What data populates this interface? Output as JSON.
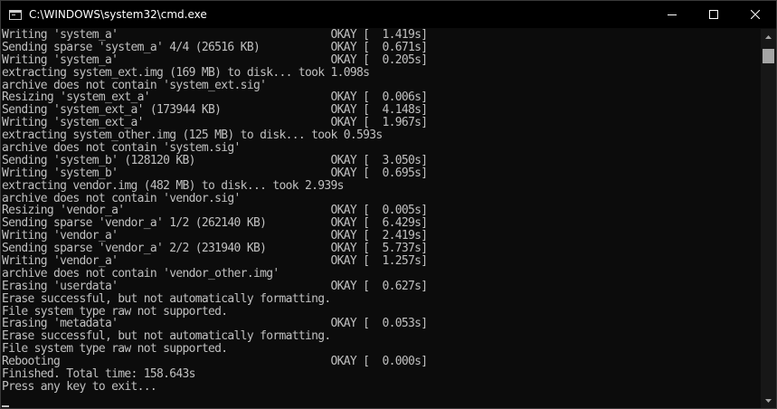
{
  "window": {
    "title": "C:\\WINDOWS\\system32\\cmd.exe"
  },
  "caption": {
    "minimize_icon": "minimize-icon",
    "maximize_icon": "maximize-icon",
    "close_icon": "close-icon"
  },
  "console": {
    "lines": [
      "Writing 'system_a'                                 OKAY [  1.419s]",
      "Sending sparse 'system_a' 4/4 (26516 KB)           OKAY [  0.671s]",
      "Writing 'system_a'                                 OKAY [  0.205s]",
      "extracting system_ext.img (169 MB) to disk... took 1.098s",
      "archive does not contain 'system_ext.sig'",
      "Resizing 'system_ext_a'                            OKAY [  0.006s]",
      "Sending 'system_ext_a' (173944 KB)                 OKAY [  4.148s]",
      "Writing 'system_ext_a'                             OKAY [  1.967s]",
      "extracting system_other.img (125 MB) to disk... took 0.593s",
      "archive does not contain 'system.sig'",
      "Sending 'system_b' (128120 KB)                     OKAY [  3.050s]",
      "Writing 'system_b'                                 OKAY [  0.695s]",
      "extracting vendor.img (482 MB) to disk... took 2.939s",
      "archive does not contain 'vendor.sig'",
      "Resizing 'vendor_a'                                OKAY [  0.005s]",
      "Sending sparse 'vendor_a' 1/2 (262140 KB)          OKAY [  6.429s]",
      "Writing 'vendor_a'                                 OKAY [  2.419s]",
      "Sending sparse 'vendor_a' 2/2 (231940 KB)          OKAY [  5.737s]",
      "Writing 'vendor_a'                                 OKAY [  1.257s]",
      "archive does not contain 'vendor_other.img'",
      "Erasing 'userdata'                                 OKAY [  0.627s]",
      "Erase successful, but not automatically formatting.",
      "File system type raw not supported.",
      "Erasing 'metadata'                                 OKAY [  0.053s]",
      "Erase successful, but not automatically formatting.",
      "File system type raw not supported.",
      "Rebooting                                          OKAY [  0.000s]",
      "Finished. Total time: 158.643s",
      "Press any key to exit..."
    ]
  },
  "colors": {
    "console_bg": "#0c0c0c",
    "console_text": "#c0c0c0",
    "titlebar_bg": "#000000",
    "titlebar_text": "#ffffff",
    "scrollbar_thumb": "#a6a6a6"
  }
}
